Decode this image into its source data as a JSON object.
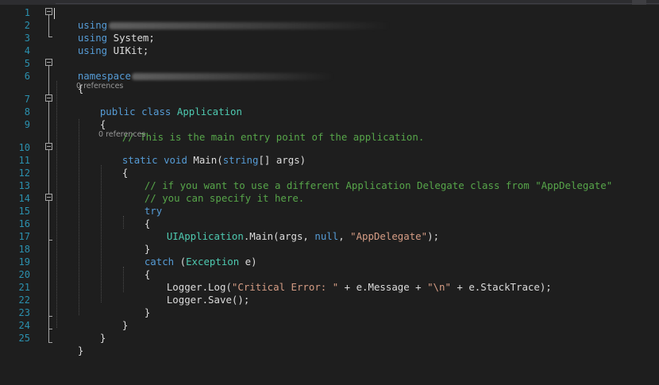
{
  "editor": {
    "colors": {
      "background": "#1e1e1e",
      "line_number": "#2b91af",
      "keyword": "#569cd6",
      "type": "#4ec9b0",
      "string": "#d69d85",
      "comment": "#57a64a",
      "text": "#dcdcdc",
      "codelens": "#999999"
    },
    "line_numbers": [
      "1",
      "2",
      "3",
      "4",
      "5",
      "6",
      "7",
      "8",
      "9",
      "10",
      "11",
      "12",
      "13",
      "14",
      "15",
      "16",
      "17",
      "18",
      "19",
      "20",
      "21",
      "22",
      "23",
      "24",
      "25"
    ],
    "codelens": {
      "application_refs": "0 references",
      "main_refs": "0 references"
    },
    "lines": {
      "l1": {
        "kw": "using"
      },
      "l2": {
        "kw": "using",
        "rest": " System;"
      },
      "l3": {
        "kw": "using",
        "rest": " UIKit;"
      },
      "l5": {
        "kw": "namespace"
      },
      "l6": {
        "text": "{"
      },
      "l7": {
        "kw1": "public",
        "sp": " ",
        "kw2": "class",
        "sp2": " ",
        "type": "Application"
      },
      "l8": {
        "text": "{"
      },
      "l9": {
        "comment": "// This is the main entry point of the application."
      },
      "l10": {
        "kw1": "static",
        "sp": " ",
        "kw2": "void",
        "mid": " Main(",
        "kw3": "string",
        "rest": "[] args)"
      },
      "l11": {
        "text": "{"
      },
      "l12": {
        "comment": "// if you want to use a different Application Delegate class from \"AppDelegate\""
      },
      "l13": {
        "comment": "// you can specify it here."
      },
      "l14": {
        "kw": "try"
      },
      "l15": {
        "text": "{"
      },
      "l16": {
        "type": "UIApplication",
        "mid": ".Main(args, ",
        "kw": "null",
        "comma": ", ",
        "str": "\"AppDelegate\"",
        "rest": ");"
      },
      "l17": {
        "text": "}"
      },
      "l18": {
        "kw": "catch",
        "mid": " (",
        "type": "Exception",
        "rest": " e)"
      },
      "l19": {
        "text": "{"
      },
      "l20": {
        "pre": "Logger.Log(",
        "str1": "\"Critical Error: \"",
        "mid": " + e.Message + ",
        "str2": "\"\\n\"",
        "rest": " + e.StackTrace);"
      },
      "l21": {
        "text": "Logger.Save();"
      },
      "l22": {
        "text": "}"
      },
      "l23": {
        "text": "}"
      },
      "l24": {
        "text": "}"
      },
      "l25": {
        "text": "}"
      }
    }
  }
}
